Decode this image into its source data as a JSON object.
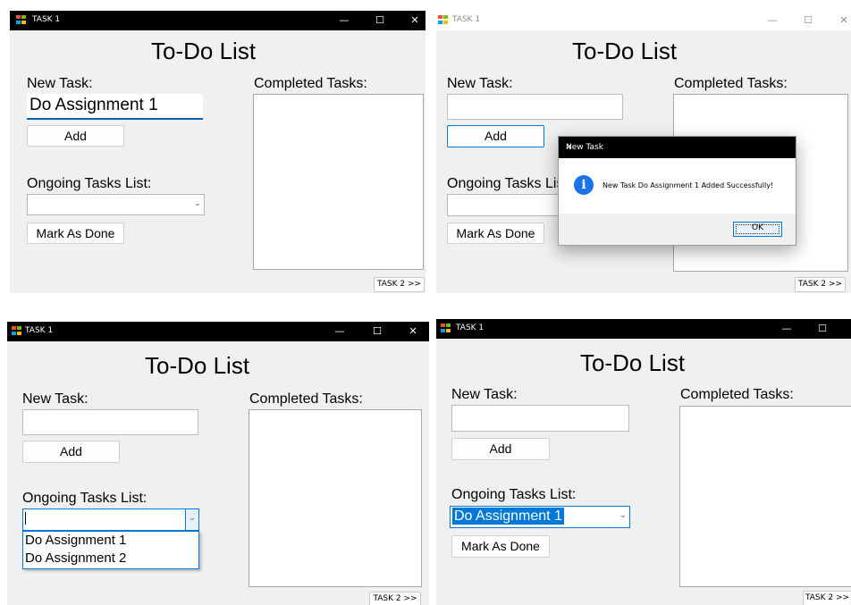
{
  "window": {
    "title": "TASK 1",
    "minimize": "—",
    "maximize": "☐",
    "close": "✕"
  },
  "form": {
    "heading": "To-Do List",
    "new_task_label": "New Task:",
    "add_label": "Add",
    "ongoing_label": "Ongoing Tasks List:",
    "mark_done_label": "Mark As Done",
    "completed_label": "Completed Tasks:",
    "task2_label": "TASK 2 >>"
  },
  "panels": {
    "top_left": {
      "new_task_value": "Do Assignment 1"
    },
    "top_right": {
      "dialog": {
        "title": "New Task",
        "message": "New Task Do Assignment 1 Added Successfully!",
        "ok_label": "OK",
        "close": "✕",
        "icon_glyph": "i"
      }
    },
    "bottom_left": {
      "dropdown_items": [
        "Do Assignment 1",
        "Do Assignment 2"
      ]
    },
    "bottom_right": {
      "selected_task": "Do Assignment 1"
    }
  },
  "icons": {
    "app_icon": "windows-forms-icon",
    "dropdown_arrow": "⌄",
    "info": "info-icon"
  },
  "colors": {
    "titlebar_dark": "#000000",
    "form_bg": "#f0f0f0",
    "accent": "#0078d7",
    "info_icon": "#1a73e8"
  }
}
